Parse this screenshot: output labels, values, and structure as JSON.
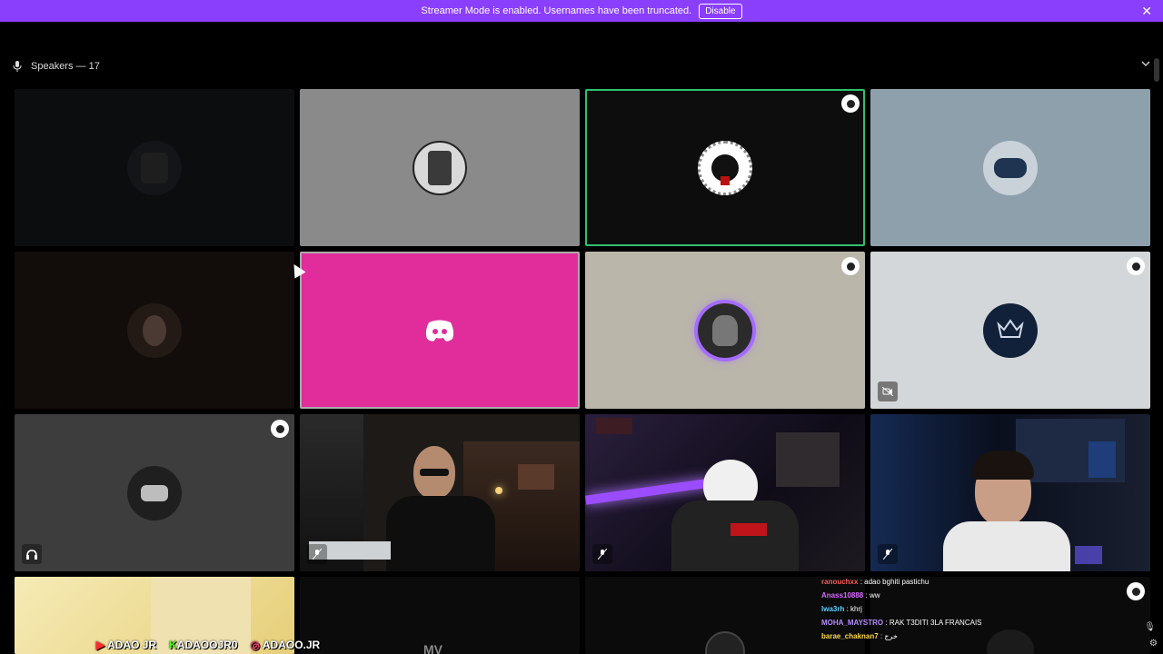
{
  "banner": {
    "message": "Streamer Mode is enabled. Usernames have been truncated.",
    "disable_label": "Disable",
    "close_glyph": "✕"
  },
  "section": {
    "title": "Speakers — 17",
    "icon": "microphone-icon"
  },
  "tiles": [
    {
      "id": 0,
      "bg": "#0c0d0f",
      "avatar": "dark-figure",
      "moderator": false
    },
    {
      "id": 1,
      "bg": "#8a8a8a",
      "avatar": "gothic-frame",
      "moderator": false
    },
    {
      "id": 2,
      "bg": "#0d0d0d",
      "avatar": "spiderweb-mask",
      "moderator": true,
      "speaking": true
    },
    {
      "id": 3,
      "bg": "#8fa0ad",
      "avatar": "blue-ninja",
      "moderator": false
    },
    {
      "id": 4,
      "bg": "#120c0a",
      "avatar": "man-portrait",
      "moderator": false
    },
    {
      "id": 5,
      "bg": "#e12d9b",
      "avatar": "discord-logo",
      "moderator": false,
      "selected": true
    },
    {
      "id": 6,
      "bg": "#bab6aa",
      "avatar": "purple-ring-avatar",
      "moderator": true
    },
    {
      "id": 7,
      "bg": "#d4d7da",
      "avatar": "goodnight-crown-logo",
      "moderator": true,
      "status_icon": "camera-off-icon"
    },
    {
      "id": 8,
      "bg": "#3d3d3d",
      "avatar": "mask-hand",
      "moderator": true,
      "status_icon": "headphones-icon"
    },
    {
      "id": 9,
      "bg": "#1d1a18",
      "avatar": "video-man-sunglasses",
      "status_icon": "muted-mic-icon"
    },
    {
      "id": 10,
      "bg": "#1b1328",
      "avatar": "video-gaming-room",
      "status_icon": "muted-mic-icon"
    },
    {
      "id": 11,
      "bg": "#111828",
      "avatar": "video-young-man",
      "status_icon": "muted-mic-icon"
    },
    {
      "id": 12,
      "bg": "#f2e4a6",
      "avatar": "video-yellow-wall"
    },
    {
      "id": 13,
      "bg": "#0b0b0b",
      "avatar": "mv-logo-text"
    },
    {
      "id": 14,
      "bg": "#0b0b0b",
      "avatar": "dark-avatar"
    },
    {
      "id": 15,
      "bg": "#0b0b0b",
      "avatar": "dark-avatar-2",
      "moderator": true
    }
  ],
  "chat": [
    {
      "name": "ranouchxx",
      "color": "#ff5a5a",
      "text": ": adao bghiti pastichu"
    },
    {
      "name": "Anass10888",
      "color": "#d76bff",
      "text": ": ww"
    },
    {
      "name": "lwa3rh",
      "color": "#5ad1ff",
      "text": ": khrj"
    },
    {
      "name": "MOHA_MAYSTRO",
      "color": "#b48cff",
      "text": ": RAK T3DITI 3LA FRANCAIS"
    },
    {
      "name": "barae_chaknan7",
      "color": "#ffd84a",
      "text": ": خرج"
    }
  ],
  "social": {
    "youtube": "ADAO JR",
    "kick": "ADAOOJR0",
    "instagram": "ADAOO.JR"
  },
  "overlay_text": {
    "mv": "MV",
    "discord": "discord"
  }
}
